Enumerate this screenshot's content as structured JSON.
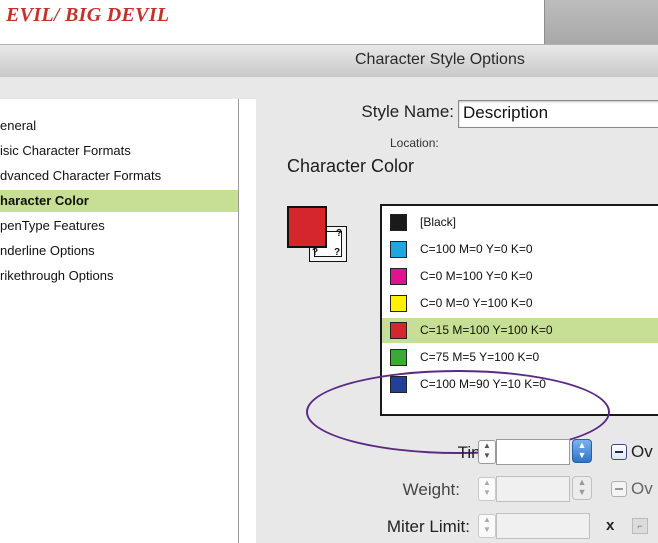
{
  "document": {
    "title": "EVIL/ BIG DEVIL"
  },
  "dialog": {
    "title": "Character Style Options",
    "nav": [
      {
        "label": "eneral"
      },
      {
        "label": "isic Character Formats"
      },
      {
        "label": "dvanced Character Formats"
      },
      {
        "label": "haracter Color",
        "selected": true
      },
      {
        "label": "penType Features"
      },
      {
        "label": "nderline Options"
      },
      {
        "label": "rikethrough Options"
      }
    ],
    "style_name_label": "Style Name:",
    "style_name_value": "Description",
    "location_label": "Location:",
    "section_heading": "Character Color",
    "preview": {
      "fill_color": "#d6262d",
      "stroke_mark": "?"
    },
    "swatches": [
      {
        "name": "[Black]",
        "color": "#1a1a1a"
      },
      {
        "name": "C=100 M=0 Y=0 K=0",
        "color": "#1fa6e0"
      },
      {
        "name": "C=0 M=100 Y=0 K=0",
        "color": "#e0138c"
      },
      {
        "name": "C=0 M=0 Y=100 K=0",
        "color": "#fff200"
      },
      {
        "name": "C=15 M=100 Y=100 K=0",
        "color": "#d6262d",
        "selected": true
      },
      {
        "name": "C=75 M=5 Y=100 K=0",
        "color": "#3aa935"
      },
      {
        "name": "C=100 M=90 Y=10 K=0",
        "color": "#22409a"
      }
    ],
    "highlight_ring_color": "#5b2a84",
    "tint_label": "Tint:",
    "tint_value": "",
    "weight_label": "Weight:",
    "weight_value": "",
    "miter_label": "Miter Limit:",
    "miter_value": "",
    "overprint_fill_label": "Ov",
    "overprint_stroke_label": "Ov",
    "miter_x": "x",
    "icons": {
      "stepper": "up-down-arrows-icon",
      "popup": "popup-arrows-icon",
      "join": "miter-join-icon"
    }
  }
}
